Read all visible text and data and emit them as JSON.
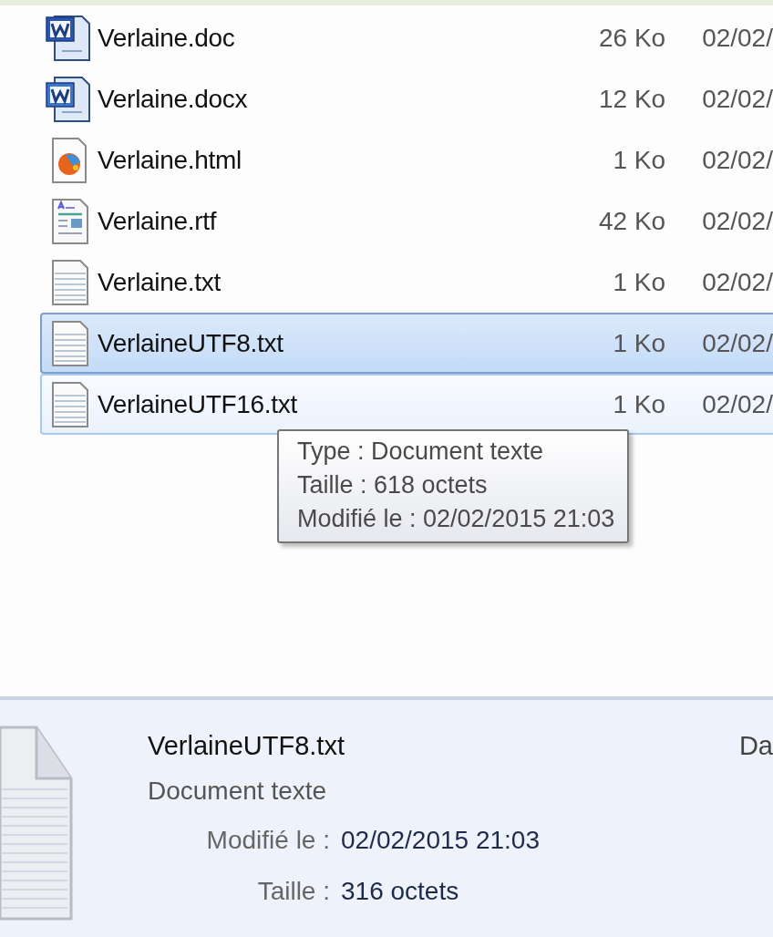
{
  "files": [
    {
      "name": "Verlaine.doc",
      "kind": "word",
      "size": "26 Ko",
      "date": "02/02/",
      "selected": false,
      "hovered": false
    },
    {
      "name": "Verlaine.docx",
      "kind": "wordx",
      "size": "12 Ko",
      "date": "02/02/",
      "selected": false,
      "hovered": false
    },
    {
      "name": "Verlaine.html",
      "kind": "web",
      "size": "1 Ko",
      "date": "02/02/",
      "selected": false,
      "hovered": false
    },
    {
      "name": "Verlaine.rtf",
      "kind": "rtf",
      "size": "42 Ko",
      "date": "02/02/",
      "selected": false,
      "hovered": false
    },
    {
      "name": "Verlaine.txt",
      "kind": "text",
      "size": "1 Ko",
      "date": "02/02/",
      "selected": false,
      "hovered": false
    },
    {
      "name": "VerlaineUTF8.txt",
      "kind": "text",
      "size": "1 Ko",
      "date": "02/02/",
      "selected": true,
      "hovered": false
    },
    {
      "name": "VerlaineUTF16.txt",
      "kind": "text",
      "size": "1 Ko",
      "date": "02/02/",
      "selected": false,
      "hovered": true
    }
  ],
  "tooltip": [
    "Type : Document texte",
    "Taille : 618 octets",
    "Modifié le : 02/02/2015 21:03"
  ],
  "details": {
    "name": "VerlaineUTF8.txt",
    "type": "Document texte",
    "cut_label": "Da",
    "fields": [
      {
        "label": "Modifié le :",
        "value": "02/02/2015 21:03"
      },
      {
        "label": "Taille :",
        "value": "316 octets"
      }
    ]
  }
}
